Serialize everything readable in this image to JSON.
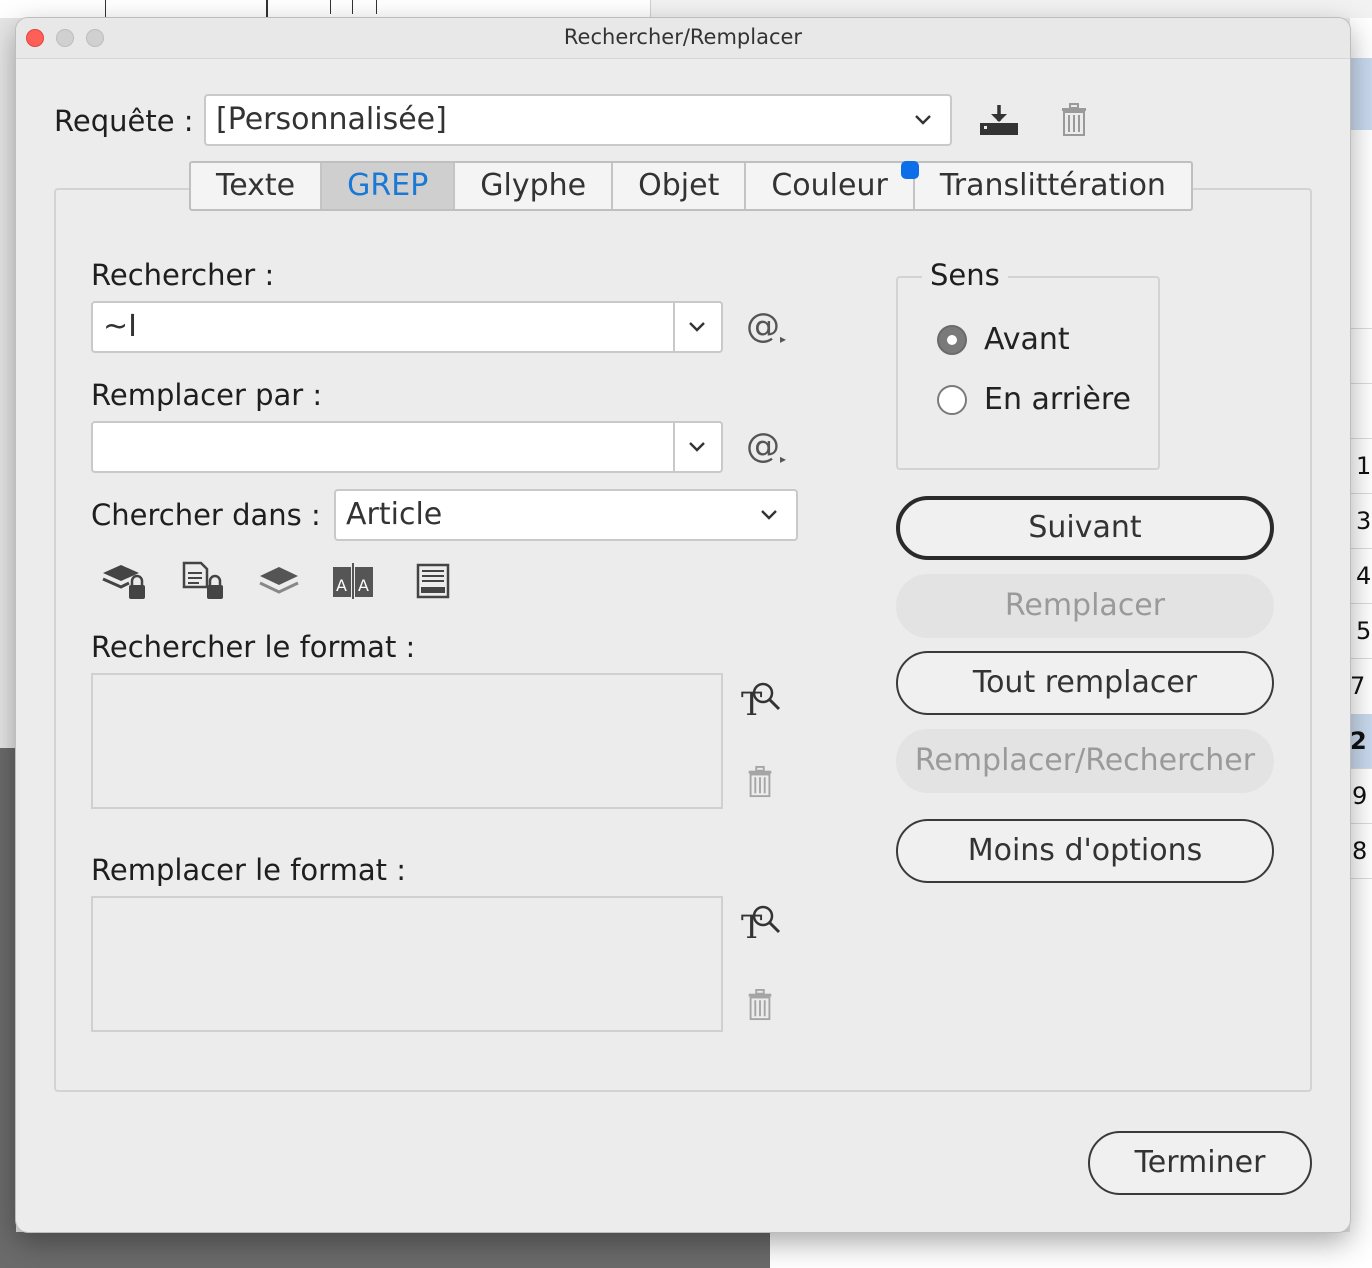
{
  "window": {
    "title": "Rechercher/Remplacer"
  },
  "query": {
    "label": "Requête :",
    "value": "[Personnalisée]"
  },
  "tabs": [
    {
      "label": "Texte"
    },
    {
      "label": "GREP"
    },
    {
      "label": "Glyphe"
    },
    {
      "label": "Objet"
    },
    {
      "label": "Couleur"
    },
    {
      "label": "Translittération"
    }
  ],
  "active_tab": "GREP",
  "search": {
    "label": "Rechercher :",
    "value": "~I"
  },
  "replace": {
    "label": "Remplacer par :",
    "value": ""
  },
  "scope": {
    "label": "Chercher dans :",
    "value": "Article"
  },
  "find_format": {
    "label": "Rechercher le format :"
  },
  "change_format": {
    "label": "Remplacer le format :"
  },
  "direction": {
    "title": "Sens",
    "options": [
      {
        "label": "Avant",
        "selected": true
      },
      {
        "label": "En arrière",
        "selected": false
      }
    ]
  },
  "buttons": {
    "next": "Suivant",
    "replace": "Remplacer",
    "replace_all": "Tout remplacer",
    "replace_find": "Remplacer/Rechercher",
    "fewer_options": "Moins d'options",
    "done": "Terminer"
  },
  "background_numbers": [
    "1",
    "3",
    "4",
    "5",
    "7",
    "2",
    "9",
    "8"
  ],
  "colors": {
    "accent": "#1a78d6",
    "badge": "#0c6ee8",
    "close": "#fe5f57"
  }
}
